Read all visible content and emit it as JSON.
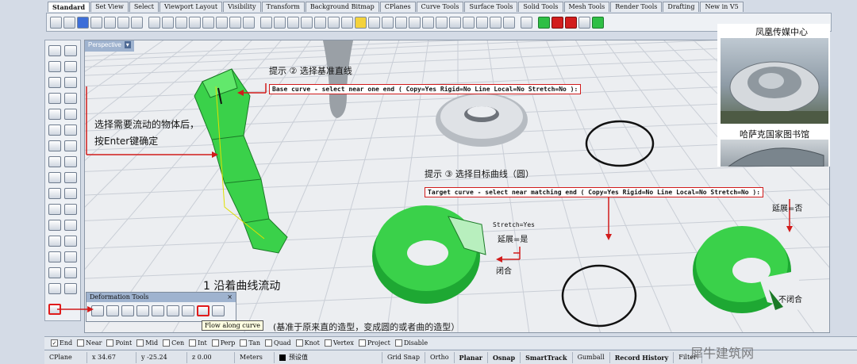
{
  "tabs": [
    "Standard",
    "Set View",
    "Select",
    "Viewport Layout",
    "Visibility",
    "Transform",
    "Background Bitmap",
    "CPlanes",
    "Curve Tools",
    "Surface Tools",
    "Solid Tools",
    "Mesh Tools",
    "Render Tools",
    "Drafting",
    "New in V5"
  ],
  "viewport": {
    "title": "Perspective",
    "menu_arrow": "▾"
  },
  "annotations": {
    "hint2": "提示 ② 选择基准直线",
    "select_object": "选择需要流动的物体后，",
    "press_enter": "按Enter键确定",
    "hint3": "提示 ③  选择目标曲线（圆）",
    "step1": "1 沿着曲线流动",
    "bottom_note": "(基准于原来直的造型，变成圆的或者曲的造型）",
    "stretch_yes_label": "Stretch=Yes",
    "extend_yes": "延展=是",
    "closed": "闭合",
    "extend_no": "延展=否",
    "not_closed": "不闭合"
  },
  "commands": {
    "base_curve": "Base curve - select near one end ( Copy=Yes  Rigid=No  Line  Local=No  Stretch=No ):",
    "target_curve": "Target curve - select near matching end ( Copy=Yes  Rigid=No  Line  Local=No  Stretch=No ):"
  },
  "photos": {
    "top_caption": "凤凰传媒中心",
    "bottom_caption": "哈萨克国家图书馆"
  },
  "deformation_tools": {
    "title": "Deformation Tools",
    "tooltip": "Flow along curve"
  },
  "osnap": [
    {
      "label": "End",
      "checked": true
    },
    {
      "label": "Near",
      "checked": false
    },
    {
      "label": "Point",
      "checked": false
    },
    {
      "label": "Mid",
      "checked": false
    },
    {
      "label": "Cen",
      "checked": false
    },
    {
      "label": "Int",
      "checked": false
    },
    {
      "label": "Perp",
      "checked": false
    },
    {
      "label": "Tan",
      "checked": false
    },
    {
      "label": "Quad",
      "checked": false
    },
    {
      "label": "Knot",
      "checked": false
    },
    {
      "label": "Vertex",
      "checked": false
    },
    {
      "label": "Project",
      "checked": false
    },
    {
      "label": "Disable",
      "checked": false
    }
  ],
  "status": {
    "cplane": "CPlane",
    "x": "x 34.67",
    "y": "y -25.24",
    "z": "z 0.00",
    "units": "Meters",
    "layer": "预设值",
    "grid_snap": "Grid Snap",
    "ortho": "Ortho",
    "planar": "Planar",
    "osnap": "Osnap",
    "smarttrack": "SmartTrack",
    "gumball": "Gumball",
    "record_history": "Record History",
    "filter": "Filter"
  },
  "watermark": "犀牛建筑网",
  "colors": {
    "accent_red": "#d11b1b",
    "object_green": "#3ad14a",
    "viewport_bg": "#eceef1"
  }
}
